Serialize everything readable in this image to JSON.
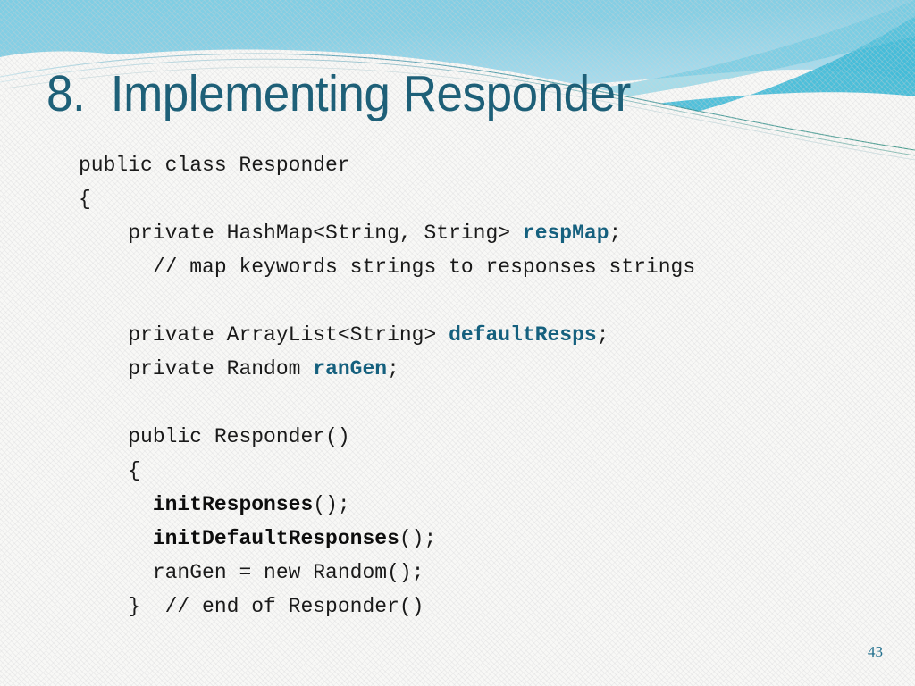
{
  "slide": {
    "title": "8.  Implementing Responder",
    "page_number": "43",
    "colors": {
      "title_teal": "#1e6078",
      "identifier_teal": "#15607e",
      "background": "#f8f8f6",
      "band_light": "#8ed3e6",
      "band_mid": "#5fc3dd",
      "band_deep": "#3cb8d4",
      "code_black": "#1a1a1a"
    }
  },
  "header": {
    "decoration_name": "wave-banner"
  },
  "code": {
    "language": "java",
    "lines": [
      {
        "indent": 0,
        "tokens": [
          {
            "t": "public class Responder",
            "style": "plain"
          }
        ]
      },
      {
        "indent": 0,
        "tokens": [
          {
            "t": "{",
            "style": "plain"
          }
        ]
      },
      {
        "indent": 2,
        "tokens": [
          {
            "t": "private HashMap<String, String> ",
            "style": "plain"
          },
          {
            "t": "respMap",
            "style": "teal"
          },
          {
            "t": ";",
            "style": "plain"
          }
        ]
      },
      {
        "indent": 3,
        "tokens": [
          {
            "t": "// map keywords strings to responses strings",
            "style": "plain"
          }
        ]
      },
      {
        "indent": 0,
        "tokens": []
      },
      {
        "indent": 2,
        "tokens": [
          {
            "t": "private ArrayList<String> ",
            "style": "plain"
          },
          {
            "t": "defaultResps",
            "style": "teal"
          },
          {
            "t": ";",
            "style": "plain"
          }
        ]
      },
      {
        "indent": 2,
        "tokens": [
          {
            "t": "private Random ",
            "style": "plain"
          },
          {
            "t": "ranGen",
            "style": "teal"
          },
          {
            "t": ";",
            "style": "plain"
          }
        ]
      },
      {
        "indent": 0,
        "tokens": []
      },
      {
        "indent": 2,
        "tokens": [
          {
            "t": "public Responder()",
            "style": "plain"
          }
        ]
      },
      {
        "indent": 2,
        "tokens": [
          {
            "t": "{",
            "style": "plain"
          }
        ]
      },
      {
        "indent": 3,
        "tokens": [
          {
            "t": "initResponses",
            "style": "bold"
          },
          {
            "t": "();",
            "style": "plain"
          }
        ]
      },
      {
        "indent": 3,
        "tokens": [
          {
            "t": "initDefaultResponses",
            "style": "bold"
          },
          {
            "t": "();",
            "style": "plain"
          }
        ]
      },
      {
        "indent": 3,
        "tokens": [
          {
            "t": "ranGen = new Random();",
            "style": "plain"
          }
        ]
      },
      {
        "indent": 2,
        "tokens": [
          {
            "t": "}  // end of Responder()",
            "style": "plain"
          }
        ]
      }
    ]
  }
}
